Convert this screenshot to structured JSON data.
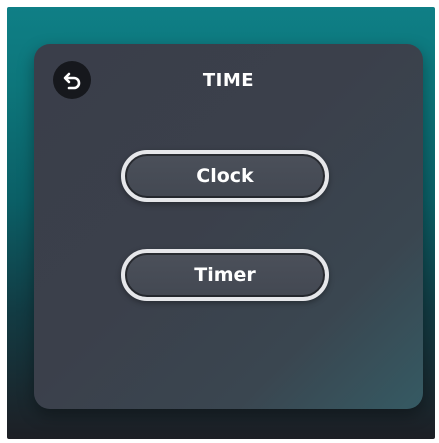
{
  "header": {
    "title": "TIME",
    "back_icon": "undo-arrow-icon"
  },
  "menu": {
    "items": [
      {
        "label": "Clock"
      },
      {
        "label": "Timer"
      }
    ]
  },
  "colors": {
    "bg_top": "#0f7f86",
    "bg_bottom": "#1d1f25",
    "panel": "#3b404b",
    "button_border": "#e6e7ea",
    "text": "#ffffff"
  }
}
